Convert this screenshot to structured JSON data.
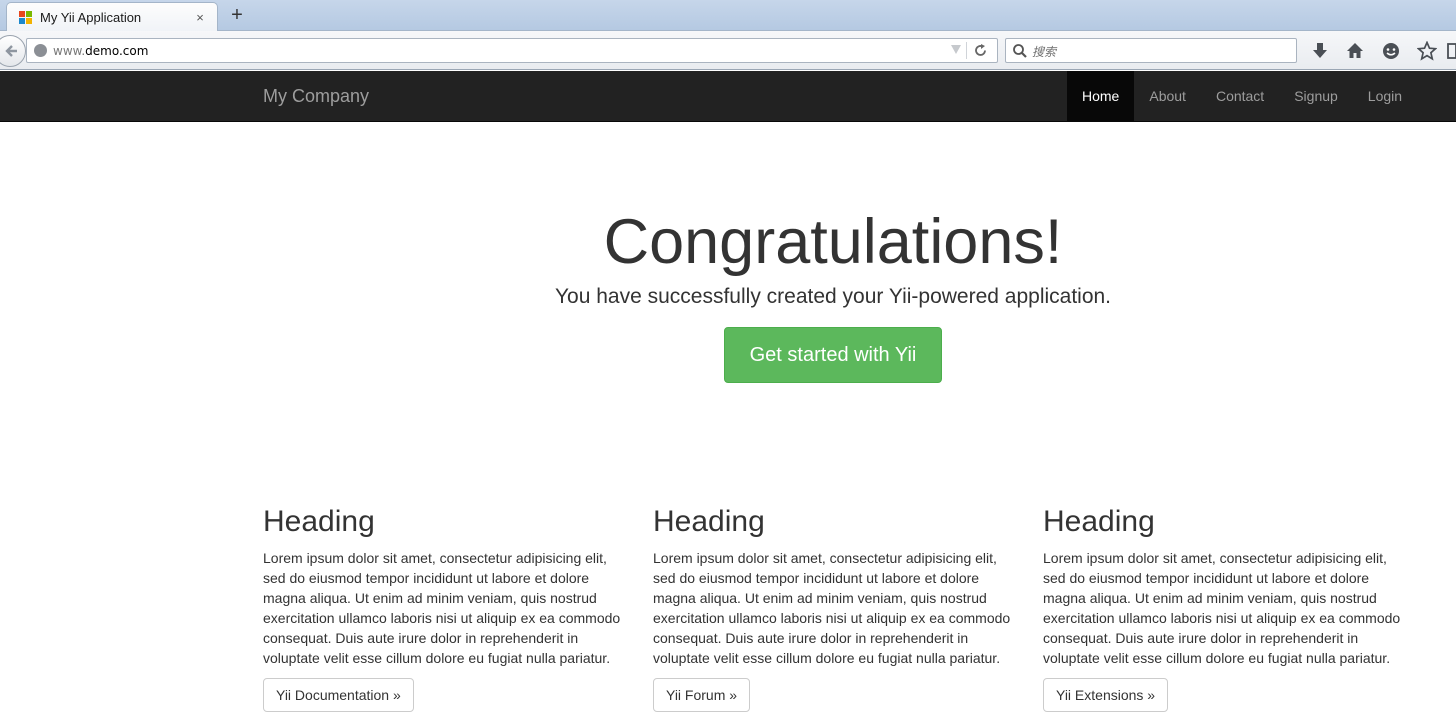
{
  "browser": {
    "tab_title": "My Yii Application",
    "tab_close": "×",
    "new_tab": "+",
    "url_prefix": "www.",
    "url_domain": "demo.com",
    "search_placeholder": "搜索"
  },
  "colors": {
    "navbar_bg": "#222222",
    "nav_active_bg": "#080808",
    "success_button": "#5cb85c"
  },
  "icons": [
    "back-arrow-icon",
    "globe-icon",
    "dropdown-arrow-icon",
    "reload-icon",
    "search-icon",
    "download-icon",
    "home-icon",
    "chat-icon",
    "bookmark-star-icon"
  ],
  "site_nav": {
    "brand": "My Company",
    "items": [
      {
        "label": "Home",
        "active": true
      },
      {
        "label": "About",
        "active": false
      },
      {
        "label": "Contact",
        "active": false
      },
      {
        "label": "Signup",
        "active": false
      },
      {
        "label": "Login",
        "active": false
      }
    ]
  },
  "jumbotron": {
    "title": "Congratulations!",
    "lead": "You have successfully created your Yii-powered application.",
    "button": "Get started with Yii"
  },
  "columns": [
    {
      "heading": "Heading",
      "text": "Lorem ipsum dolor sit amet, consectetur adipisicing elit, sed do eiusmod tempor incididunt ut labore et dolore magna aliqua. Ut enim ad minim veniam, quis nostrud exercitation ullamco laboris nisi ut aliquip ex ea commodo consequat. Duis aute irure dolor in reprehenderit in voluptate velit esse cillum dolore eu fugiat nulla pariatur.",
      "button": "Yii Documentation »"
    },
    {
      "heading": "Heading",
      "text": "Lorem ipsum dolor sit amet, consectetur adipisicing elit, sed do eiusmod tempor incididunt ut labore et dolore magna aliqua. Ut enim ad minim veniam, quis nostrud exercitation ullamco laboris nisi ut aliquip ex ea commodo consequat. Duis aute irure dolor in reprehenderit in voluptate velit esse cillum dolore eu fugiat nulla pariatur.",
      "button": "Yii Forum »"
    },
    {
      "heading": "Heading",
      "text": "Lorem ipsum dolor sit amet, consectetur adipisicing elit, sed do eiusmod tempor incididunt ut labore et dolore magna aliqua. Ut enim ad minim veniam, quis nostrud exercitation ullamco laboris nisi ut aliquip ex ea commodo consequat. Duis aute irure dolor in reprehenderit in voluptate velit esse cillum dolore eu fugiat nulla pariatur.",
      "button": "Yii Extensions »"
    }
  ]
}
